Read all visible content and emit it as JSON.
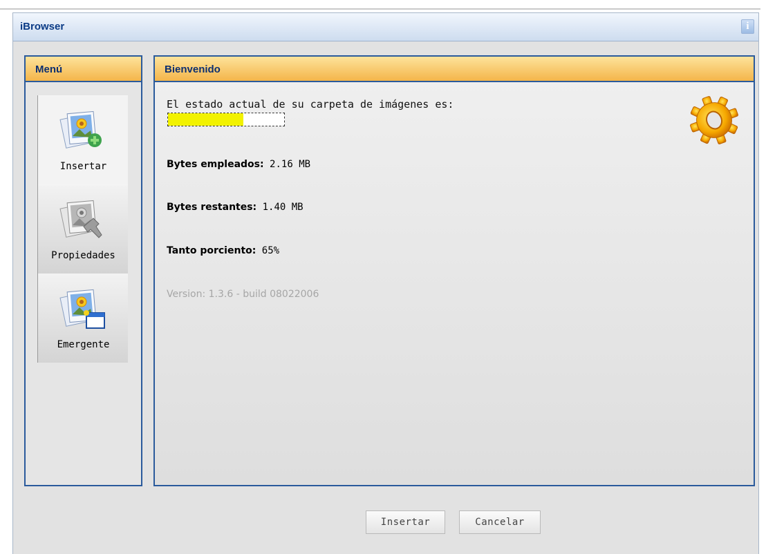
{
  "window": {
    "title": "iBrowser",
    "info_glyph": "i"
  },
  "menu": {
    "title": "Menú",
    "items": [
      {
        "label": "Insertar",
        "icon": "insert-image-icon"
      },
      {
        "label": "Propiedades",
        "icon": "image-properties-icon"
      },
      {
        "label": "Emergente",
        "icon": "popup-window-icon"
      }
    ]
  },
  "main": {
    "title": "Bienvenido",
    "status_intro": "El estado actual de su carpeta de imágenes es:",
    "usage_percent": 65,
    "bytes_used_label": "Bytes empleados:",
    "bytes_used_value": "2.16 MB",
    "bytes_left_label": "Bytes restantes:",
    "bytes_left_value": "1.40 MB",
    "percent_label": "Tanto porciento:",
    "percent_value": "65%",
    "version": "Version: 1.3.6 - build 08022006",
    "gear_icon": "gear-icon"
  },
  "buttons": {
    "insert": "Insertar",
    "cancel": "Cancelar"
  },
  "colors": {
    "accent_blue": "#2a5a9c",
    "header_orange": "#f4b54a",
    "progress_yellow": "#f2f200"
  }
}
